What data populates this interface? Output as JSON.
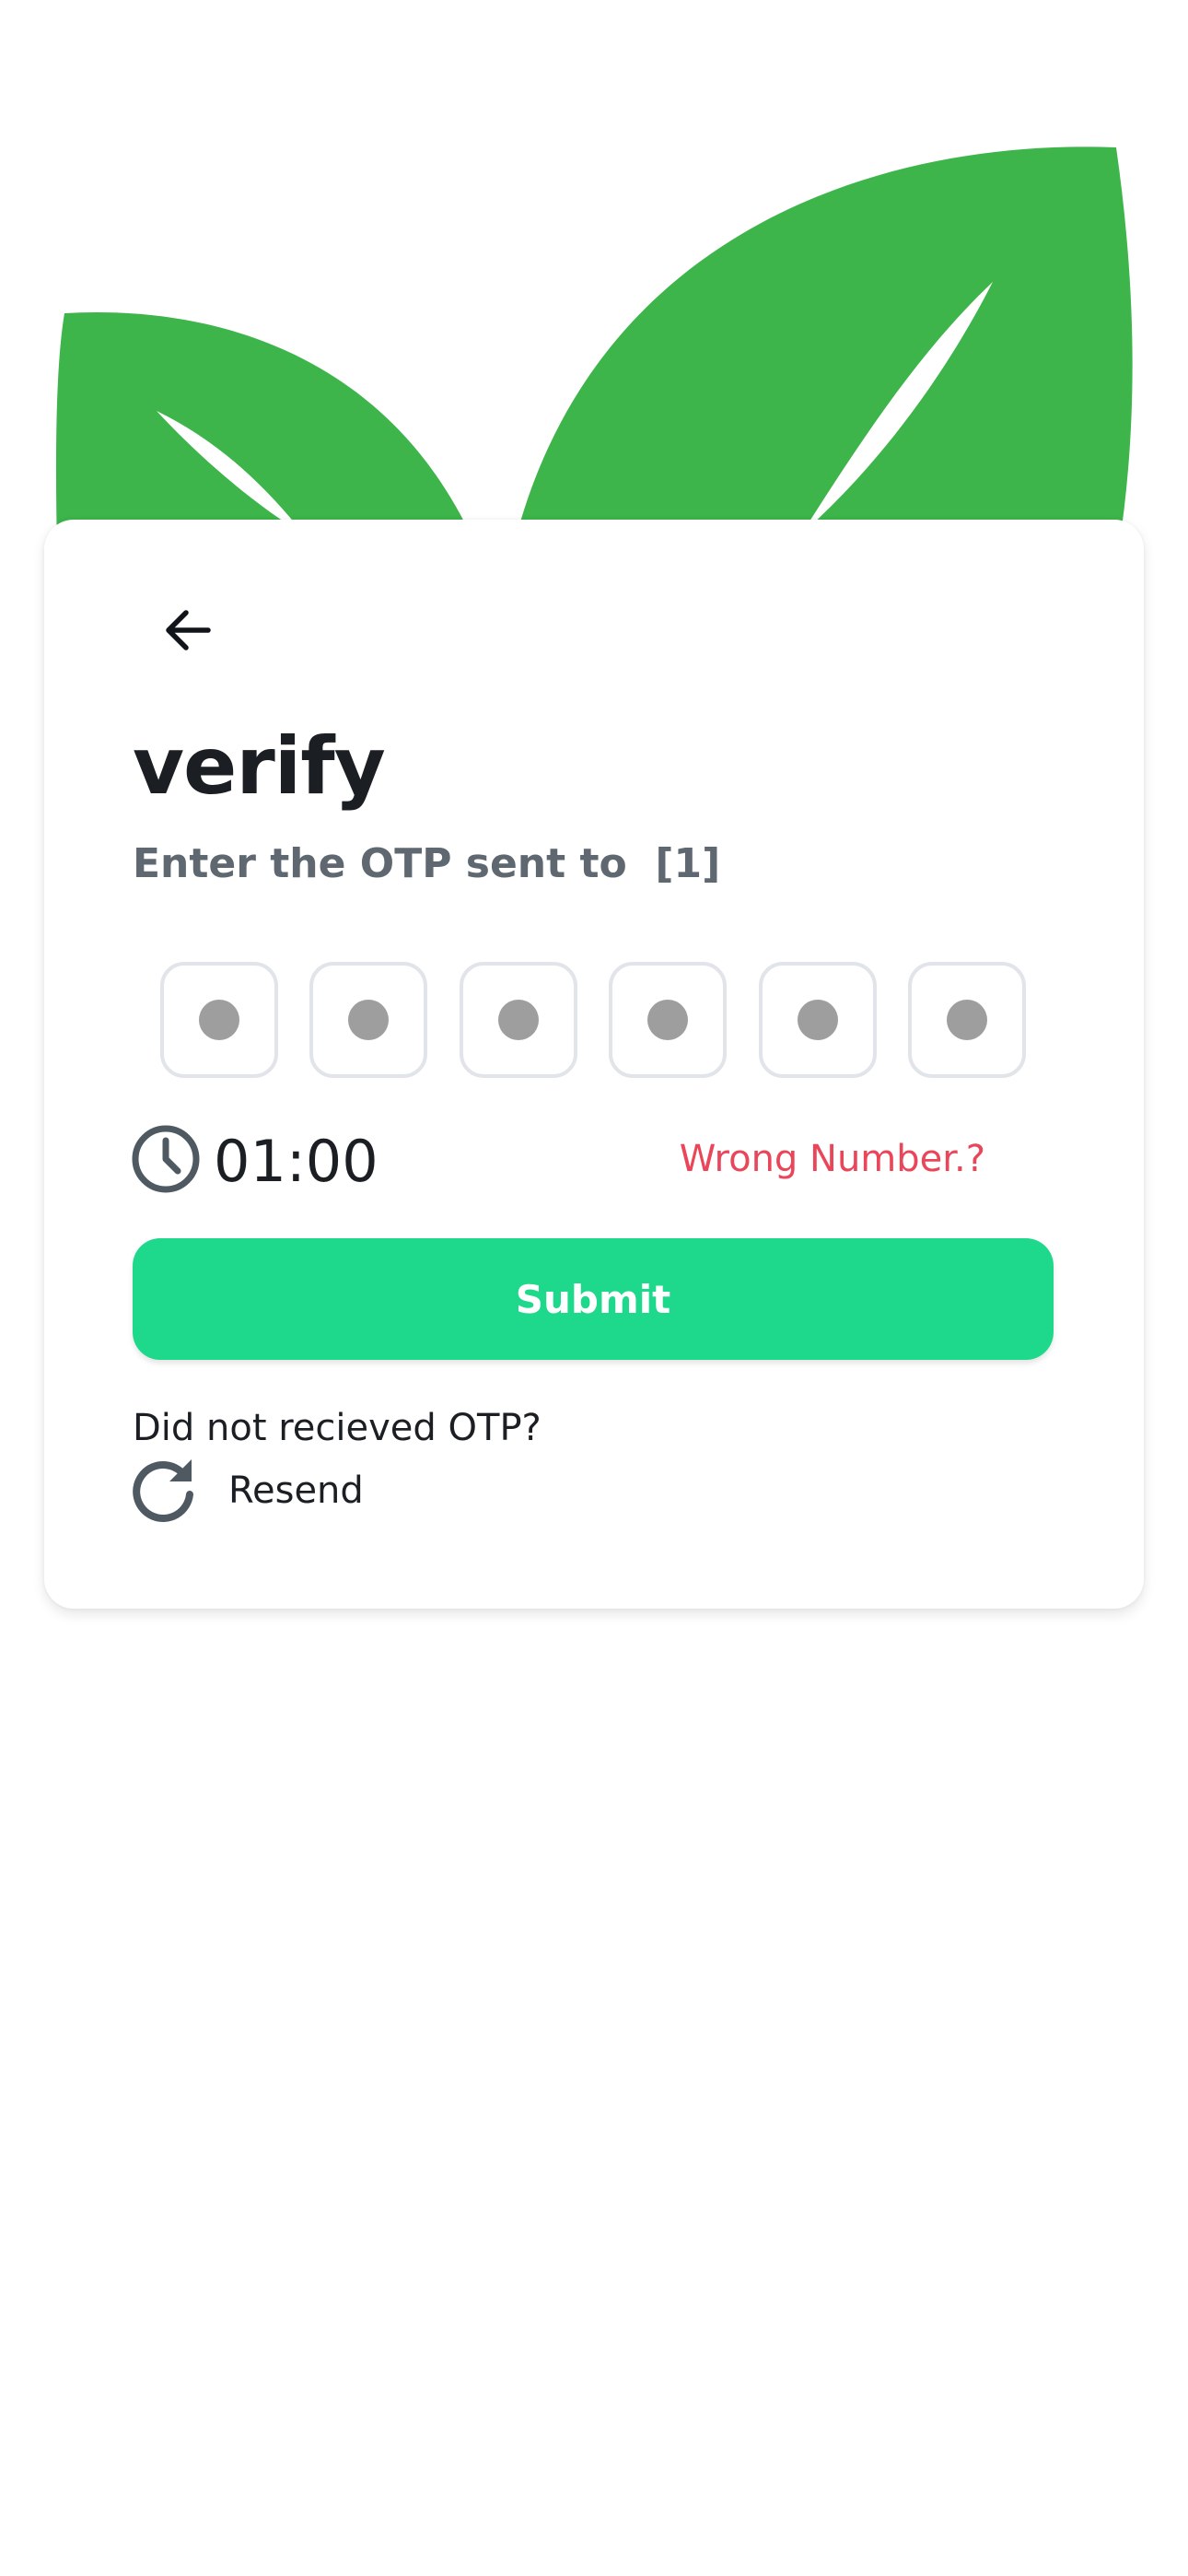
{
  "header": {
    "illustration_icon": "leaves-icon",
    "leaf_color": "#3db54a"
  },
  "card": {
    "back_icon": "arrow-left-icon",
    "title": "verify",
    "subtitle": "Enter the OTP sent to  [1]",
    "otp": {
      "digits": 6,
      "masked_value": "●●●●●●"
    },
    "timer": {
      "icon": "clock-icon",
      "value": "01:00"
    },
    "wrong_number_label": "Wrong Number.?",
    "submit_label": "Submit",
    "not_received_text": "Did not recieved OTP?",
    "resend": {
      "icon": "refresh-icon",
      "label": "Resend"
    }
  },
  "colors": {
    "accent": "#1ed98b",
    "danger": "#ea4559",
    "text_primary": "#1b1f23",
    "text_secondary": "#5f6871",
    "leaf": "#3db54a"
  }
}
